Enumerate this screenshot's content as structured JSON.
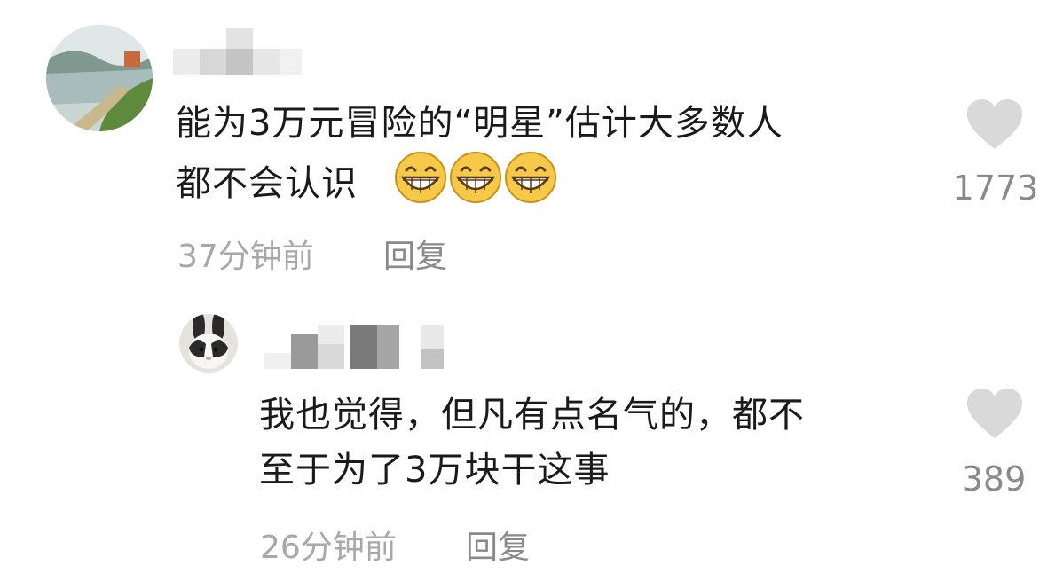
{
  "comments": [
    {
      "text_lines": [
        "能为3万元冒险的“明星”估计大多数人",
        "都不会认识"
      ],
      "emojis": [
        "grinning-face",
        "grinning-face",
        "grinning-face"
      ],
      "time": "37分钟前",
      "reply_label": "回复",
      "like_icon": "heart-icon",
      "likes": "1773",
      "replies": [
        {
          "text_lines": [
            "我也觉得，但凡有点名气的，都不",
            "至于为了3万块干这事"
          ],
          "time": "26分钟前",
          "reply_label": "回复",
          "like_icon": "heart-icon",
          "likes": "389"
        }
      ]
    }
  ],
  "colors": {
    "text": "#1a1a1a",
    "meta": "#a8a8a8",
    "heart": "#d9d9d9",
    "emoji_face": "#f7c948"
  }
}
